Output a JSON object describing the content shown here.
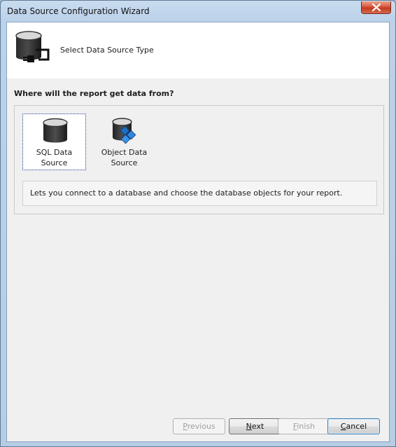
{
  "window": {
    "title": "Data Source Configuration Wizard",
    "close_icon": "close-icon"
  },
  "header": {
    "title": "Select Data Source Type",
    "icon": "database-plug-icon"
  },
  "content": {
    "question": "Where will the report get data from?",
    "options": [
      {
        "label": "SQL Data\nSource",
        "icon": "sql-database-icon",
        "selected": true
      },
      {
        "label": "Object Data\nSource",
        "icon": "object-database-icon",
        "selected": false
      }
    ],
    "description": "Lets you connect to a database and choose the database objects for your report."
  },
  "buttons": {
    "previous": {
      "mnemonic": "P",
      "rest": "revious",
      "enabled": false
    },
    "next": {
      "mnemonic": "N",
      "rest": "ext",
      "enabled": true
    },
    "finish": {
      "mnemonic": "F",
      "rest": "inish",
      "enabled": false
    },
    "cancel": {
      "mnemonic": "C",
      "rest": "ancel",
      "enabled": true
    }
  },
  "colors": {
    "selection_border": "#1f3b8a",
    "cancel_accent": "#3c7fb1",
    "close_button": "#c23a20"
  }
}
